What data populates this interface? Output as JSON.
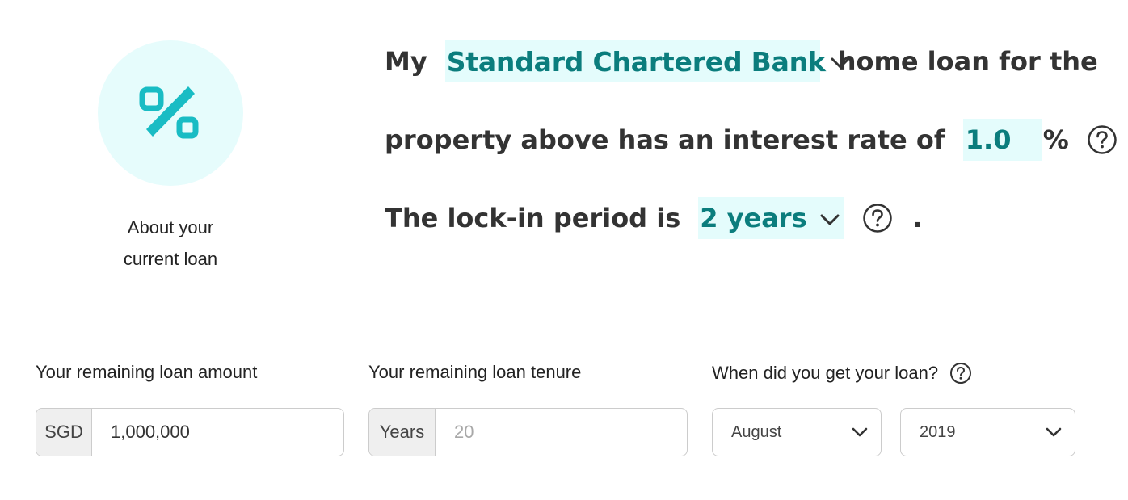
{
  "section": {
    "icon": "percent-icon",
    "label_line1": "About your",
    "label_line2": "current loan"
  },
  "sentence": {
    "line1_prefix": "My",
    "bank_selected": "Standard Chartered Bank",
    "line1_suffix": "home loan for the",
    "line2_prefix": "property above has an interest rate of",
    "interest_rate": "1.0",
    "percent_sign": "%",
    "line2_end": ".",
    "line3_prefix": "The lock-in period is",
    "lock_in_selected": "2 years",
    "line3_end": "."
  },
  "loan_amount": {
    "label": "Your remaining loan amount",
    "addon": "SGD",
    "value": "1,000,000"
  },
  "loan_tenure": {
    "label": "Your remaining loan tenure",
    "addon": "Years",
    "placeholder": "20"
  },
  "loan_date": {
    "label": "When did you get your loan?",
    "month": "August",
    "year": "2019"
  },
  "colors": {
    "accent": "#0b7d7d",
    "chip_background": "#e4fcfc",
    "icon_circle": "#e6fcfc",
    "icon_teal": "#19bcc4"
  }
}
